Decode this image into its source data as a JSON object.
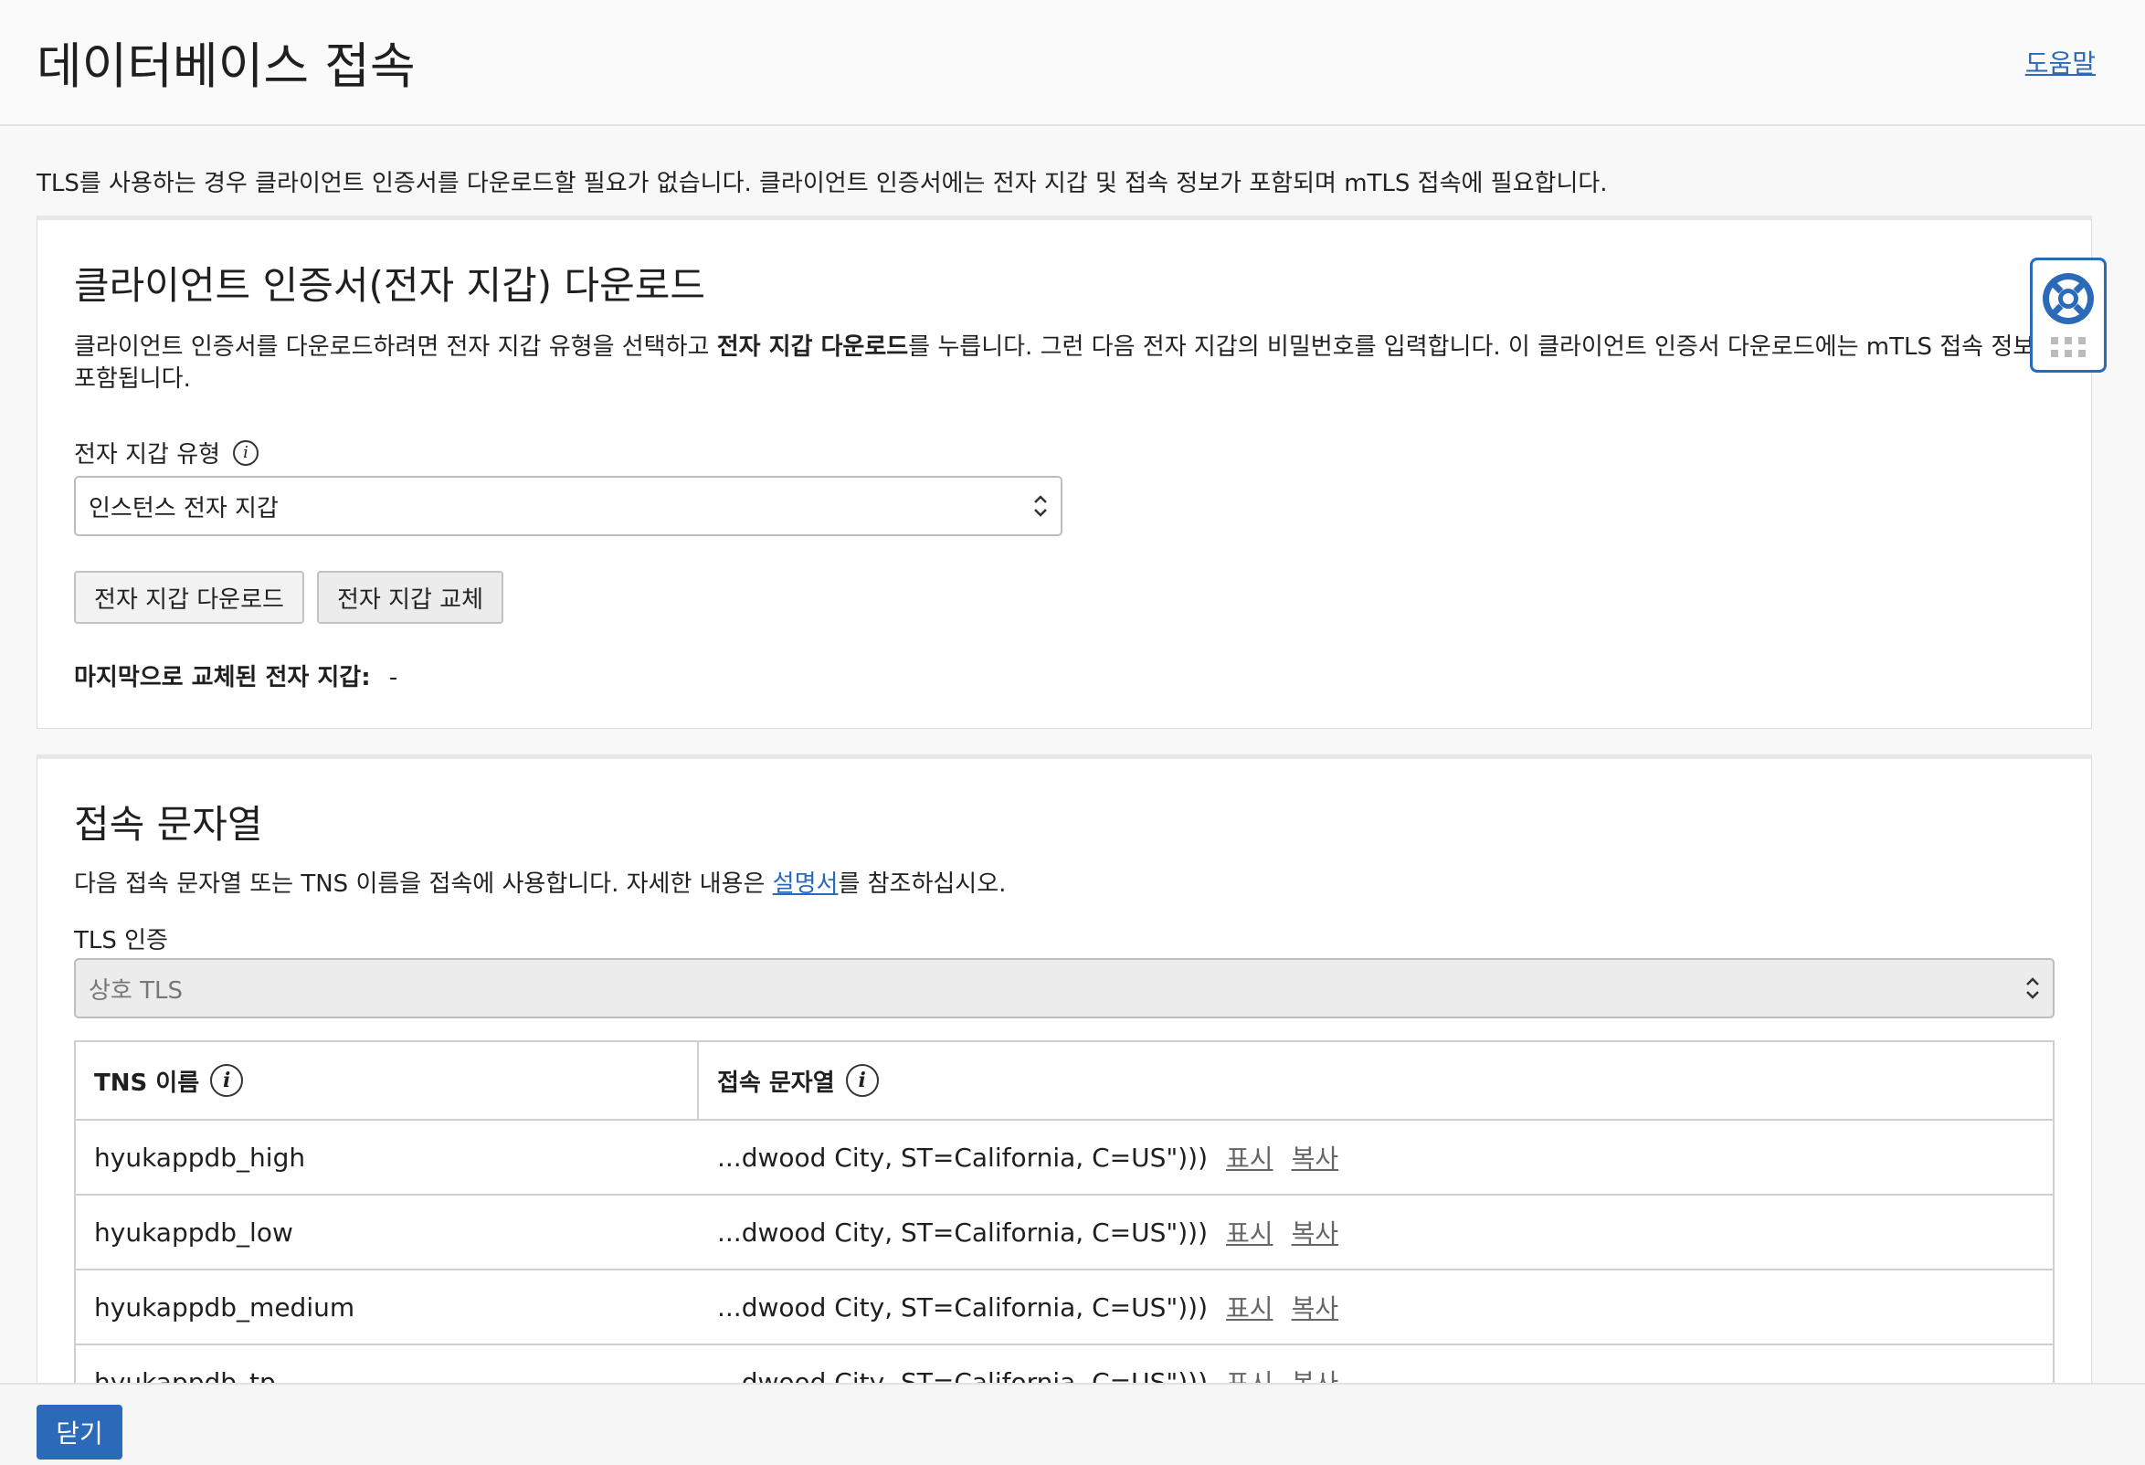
{
  "header": {
    "title": "데이터베이스 접속",
    "help_label": "도움말"
  },
  "intro_text": "TLS를 사용하는 경우 클라이언트 인증서를 다운로드할 필요가 없습니다. 클라이언트 인증서에는 전자 지갑 및 접속 정보가 포함되며 mTLS 접속에 필요합니다.",
  "wallet_section": {
    "title": "클라이언트 인증서(전자 지갑) 다운로드",
    "desc_part1": "클라이언트 인증서를 다운로드하려면 전자 지갑 유형을 선택하고 ",
    "desc_bold": "전자 지갑 다운로드",
    "desc_part2": "를 누릅니다. 그런 다음 전자 지갑의 비밀번호를 입력합니다. 이 클라이언트 인증서 다운로드에는 mTLS 접속 정보만 포함됩니다.",
    "type_label": "전자 지갑 유형",
    "type_value": "인스턴스 전자 지갑",
    "download_button": "전자 지갑 다운로드",
    "rotate_button": "전자 지갑 교체",
    "last_rotated_label": "마지막으로 교체된 전자 지갑:",
    "last_rotated_value": "-"
  },
  "conn_section": {
    "title": "접속 문자열",
    "desc_part1": "다음 접속 문자열 또는 TNS 이름을 접속에 사용합니다. 자세한 내용은 ",
    "desc_link": "설명서",
    "desc_part2": "를 참조하십시오.",
    "tls_label": "TLS 인증",
    "tls_value": "상호 TLS",
    "table": {
      "col_tns": "TNS 이름",
      "col_conn": "접속 문자열",
      "rows": [
        {
          "tns": "hyukappdb_high",
          "conn": "...dwood City, ST=California, C=US\")))",
          "show": "표시",
          "copy": "복사"
        },
        {
          "tns": "hyukappdb_low",
          "conn": "...dwood City, ST=California, C=US\")))",
          "show": "표시",
          "copy": "복사"
        },
        {
          "tns": "hyukappdb_medium",
          "conn": "...dwood City, ST=California, C=US\")))",
          "show": "표시",
          "copy": "복사"
        },
        {
          "tns": "hyukappdb_tp",
          "conn": "...dwood City, ST=California, C=US\")))",
          "show": "표시",
          "copy": "복사"
        }
      ]
    }
  },
  "footer": {
    "close_label": "닫기"
  },
  "widget": {
    "icon": "lifebuoy-icon"
  },
  "colors": {
    "accent": "#2a6ab8"
  }
}
